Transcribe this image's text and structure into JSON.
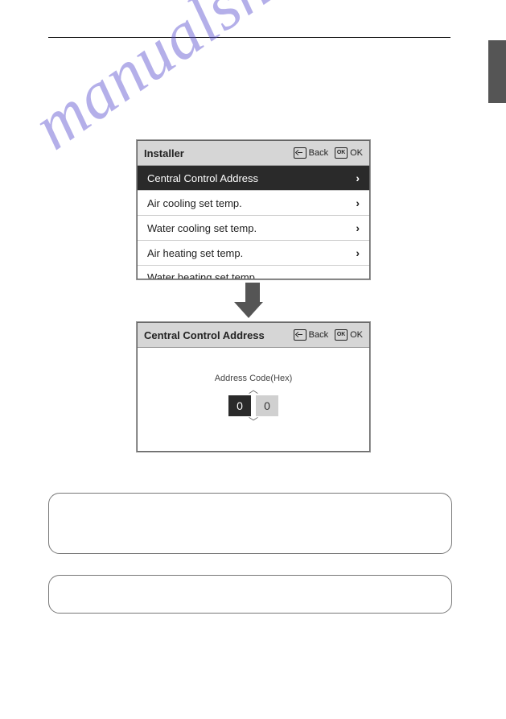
{
  "watermark": "manualshive.com",
  "panel1": {
    "title": "Installer",
    "back": "Back",
    "ok": "OK",
    "items": [
      {
        "label": "Central Control Address",
        "selected": true
      },
      {
        "label": "Air cooling set temp.",
        "selected": false
      },
      {
        "label": "Water cooling set temp.",
        "selected": false
      },
      {
        "label": "Air heating set temp.",
        "selected": false
      }
    ],
    "cutoff": "Water heating set temp."
  },
  "panel2": {
    "title": "Central Control Address",
    "back": "Back",
    "ok": "OK",
    "address_label": "Address Code(Hex)",
    "digits": [
      "0",
      "0"
    ]
  }
}
